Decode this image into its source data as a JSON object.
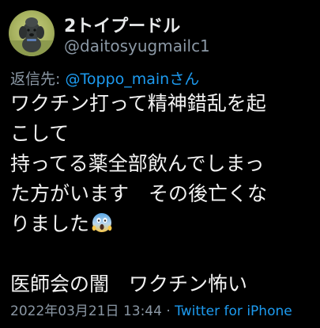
{
  "user": {
    "display_name": "2トイプードル",
    "handle": "@daitosyugmailc1"
  },
  "reply": {
    "prefix": "返信先:",
    "mention": "@Toppo_main",
    "suffix": "さん"
  },
  "body": {
    "lines": [
      "ワクチン打って精神錯乱を起",
      "こして",
      "持ってる薬全部飲んでしまっ",
      "た方がいます　その後亡くな",
      "りました",
      "",
      "医師会の闇　ワクチン怖い"
    ],
    "emoji": "screaming-face-emoji"
  },
  "meta": {
    "date": "2022年03月21日",
    "time": "13:44",
    "separator": "·",
    "source": "Twitter for iPhone"
  },
  "colors": {
    "background": "#000000",
    "text": "#e7e9ea",
    "secondary": "#8b98a5",
    "link": "#1d9bf0"
  }
}
